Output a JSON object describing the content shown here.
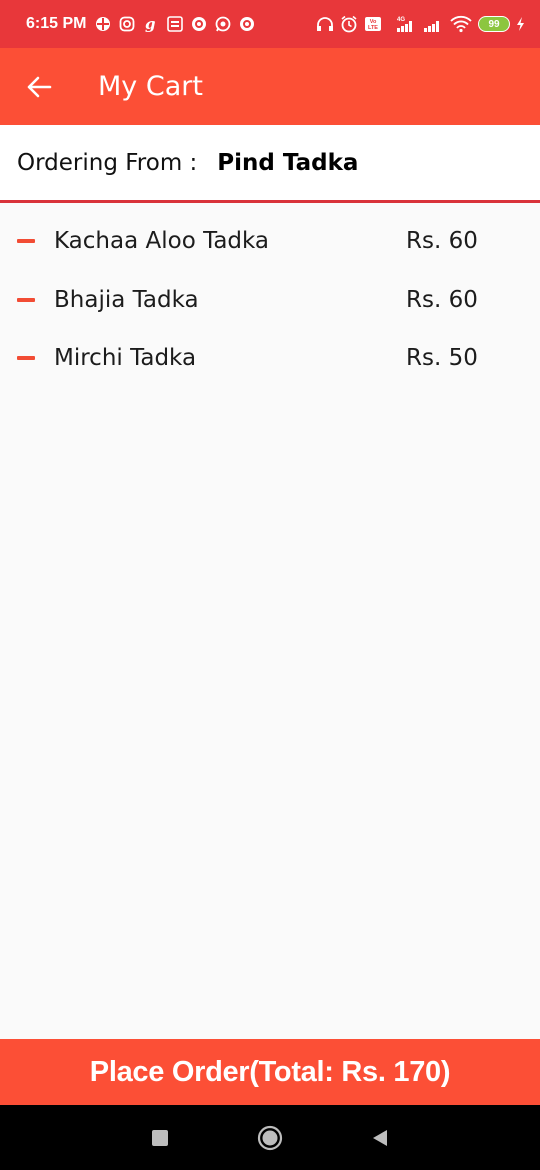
{
  "status_bar": {
    "time": "6:15 PM",
    "network_label": "4G",
    "volte_label": "Vo LTE",
    "battery": "99",
    "left_icons": [
      "helm-icon",
      "instagram-icon",
      "g-icon",
      "news-icon",
      "at-icon",
      "whatsapp-icon",
      "at-icon"
    ],
    "right_icons": [
      "headphones-icon",
      "alarm-icon",
      "volte-icon",
      "signal-icon",
      "signal-icon",
      "wifi-icon",
      "battery-icon",
      "charging-icon"
    ]
  },
  "app_bar": {
    "title": "My Cart",
    "back_icon": "arrow-left-icon",
    "color": "#fc4f36"
  },
  "ordering_from": {
    "label": "Ordering From :",
    "restaurant": "Pind Tadka"
  },
  "cart_items": [
    {
      "name": "Kachaa Aloo Tadka",
      "price": "Rs. 60"
    },
    {
      "name": "Bhajia Tadka",
      "price": "Rs. 60"
    },
    {
      "name": "Mirchi Tadka",
      "price": "Rs. 50"
    }
  ],
  "place_order": {
    "label": "Place Order(Total: Rs. 170)"
  },
  "nav_bar": {
    "icons": [
      "square-recents-icon",
      "circle-home-icon",
      "triangle-back-icon"
    ]
  },
  "colors": {
    "status_bar": "#e8373a",
    "accent": "#fc4f36",
    "divider": "#d9323a"
  }
}
